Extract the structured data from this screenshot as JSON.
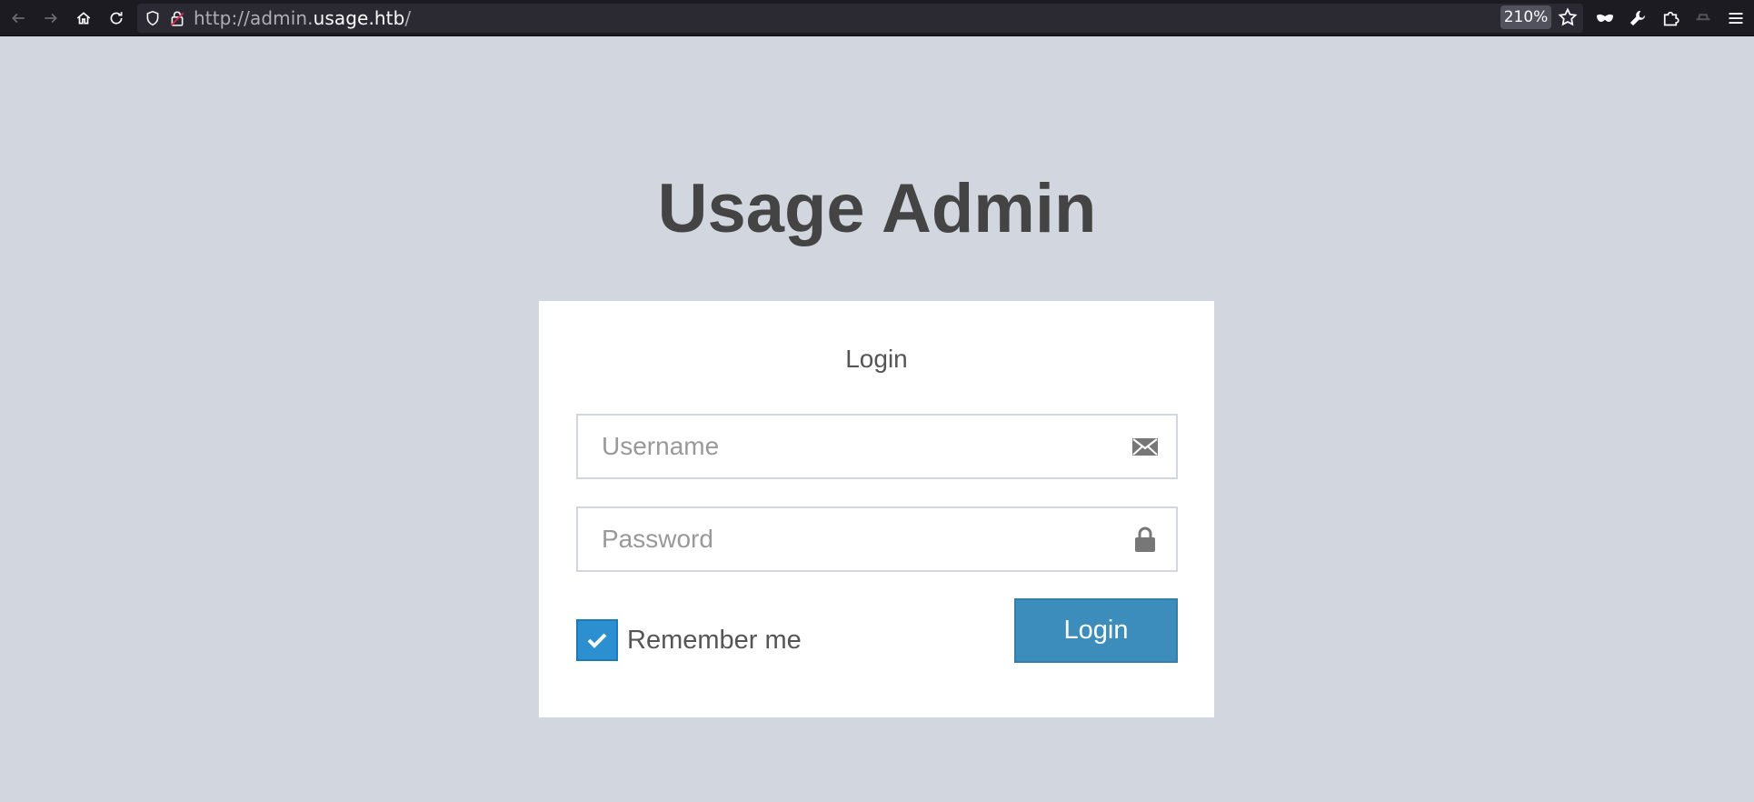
{
  "browser": {
    "url_scheme": "http://admin.",
    "url_host": "usage.htb",
    "url_suffix": "/",
    "zoom": "210%"
  },
  "page": {
    "title": "Usage Admin"
  },
  "login_form": {
    "heading": "Login",
    "username_placeholder": "Username",
    "password_placeholder": "Password",
    "remember_label": "Remember me",
    "remember_checked": true,
    "submit_label": "Login"
  },
  "colors": {
    "page_background": "#d2d6df",
    "button_primary": "#3c8dbc",
    "checkbox_checked": "#2b8fd0",
    "title_text": "#444444"
  }
}
